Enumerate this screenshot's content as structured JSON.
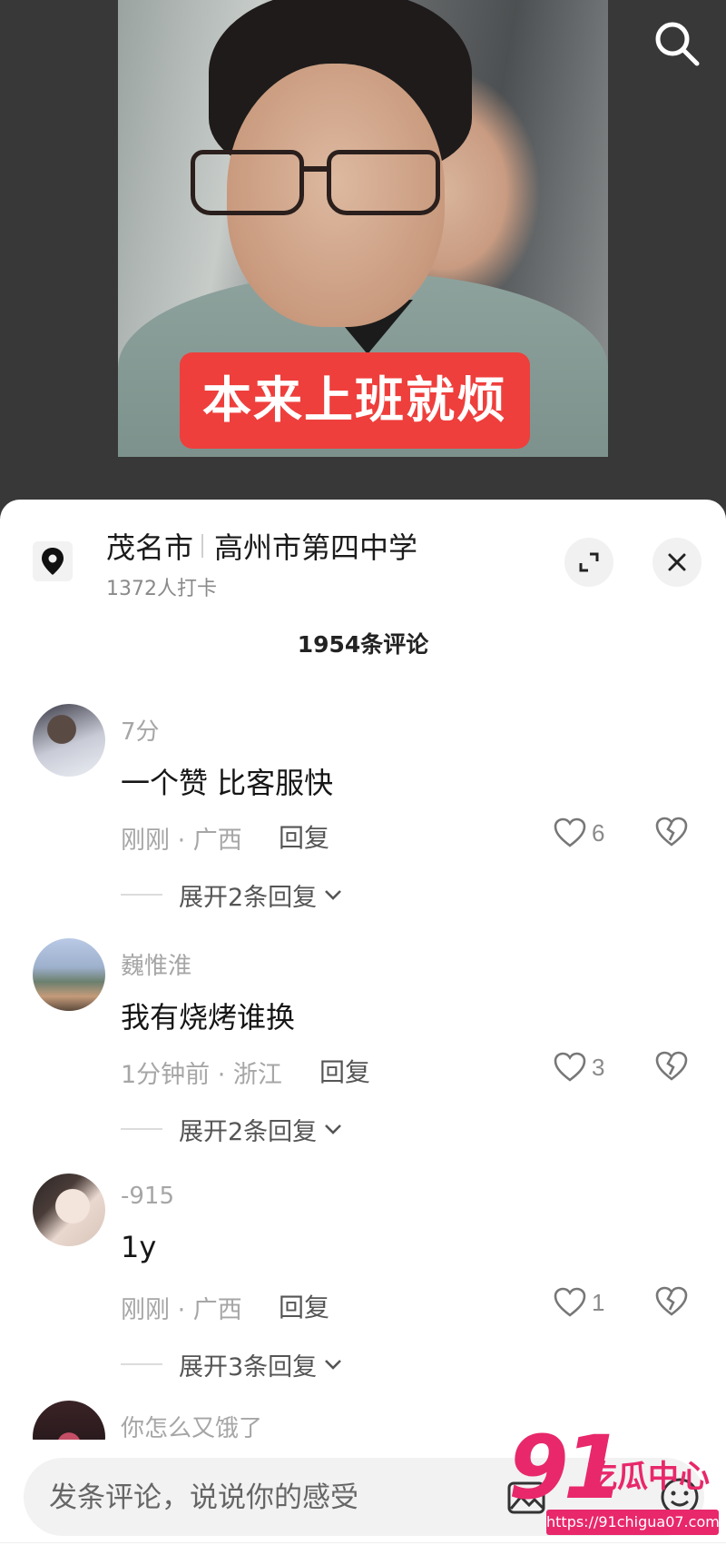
{
  "video": {
    "caption": "本来上班就烦",
    "search_icon": "search-icon"
  },
  "location": {
    "city": "茂名市",
    "place": "高州市第四中学",
    "checkins": "1372人打卡",
    "pin_icon": "location-pin-icon",
    "expand_icon": "expand-icon",
    "close_icon": "close-icon"
  },
  "comments_header": {
    "count": "1954条评论"
  },
  "comments": [
    {
      "user": "7分",
      "text": "一个赞 比客服快",
      "meta": "刚刚 · 广西",
      "reply_label": "回复",
      "likes": "6",
      "expand_label": "展开2条回复"
    },
    {
      "user": "巍惟淮",
      "text": "我有烧烤谁换",
      "meta": "1分钟前 · 浙江",
      "reply_label": "回复",
      "likes": "3",
      "expand_label": "展开2条回复"
    },
    {
      "user": "-915",
      "text": "1y",
      "meta": "刚刚 · 广西",
      "reply_label": "回复",
      "likes": "1",
      "expand_label": "展开3条回复"
    },
    {
      "user": "你怎么又饿了"
    }
  ],
  "input": {
    "placeholder": "发条评论，说说你的感受"
  },
  "watermark": {
    "number": "91",
    "name": "吃瓜中心",
    "url": "https://91chigua07.com"
  },
  "colors": {
    "caption_bg": "#ee3f3c",
    "watermark": "#e8286b",
    "sheet_bg": "#ffffff",
    "video_bg": "#383838"
  }
}
